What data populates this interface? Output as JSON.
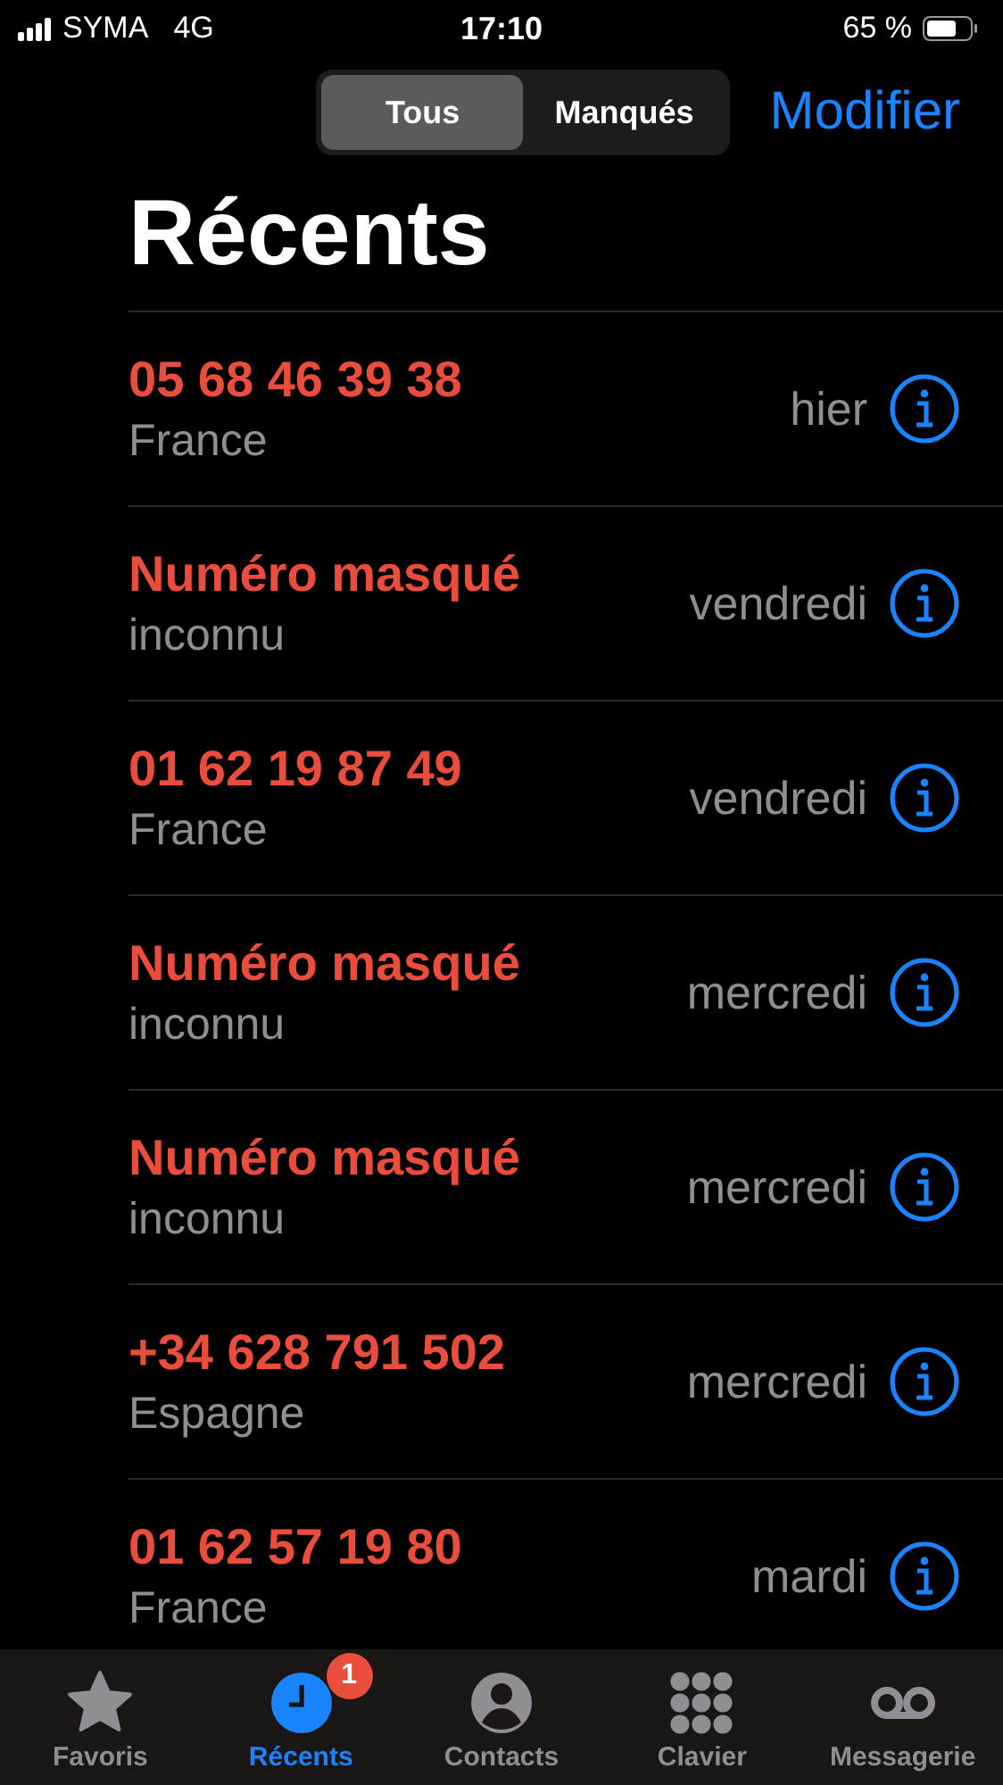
{
  "status_bar": {
    "carrier": "SYMA",
    "network": "4G",
    "time": "17:10",
    "battery": "65 %"
  },
  "segments": [
    {
      "label": "Tous",
      "selected": true
    },
    {
      "label": "Manqués",
      "selected": false
    }
  ],
  "edit_button": "Modifier",
  "title": "Récents",
  "calls": [
    {
      "caller": "05 68 46 39 38",
      "detail": "France",
      "date": "hier",
      "missed": true
    },
    {
      "caller": "Numéro masqué",
      "detail": "inconnu",
      "date": "vendredi",
      "missed": true
    },
    {
      "caller": "01 62 19 87 49",
      "detail": "France",
      "date": "vendredi",
      "missed": true
    },
    {
      "caller": "Numéro masqué",
      "detail": "inconnu",
      "date": "mercredi",
      "missed": true
    },
    {
      "caller": "Numéro masqué",
      "detail": "inconnu",
      "date": "mercredi",
      "missed": true
    },
    {
      "caller": "+34 628 791 502",
      "detail": "Espagne",
      "date": "mercredi",
      "missed": true
    },
    {
      "caller": "01 62 57 19 80",
      "detail": "France",
      "date": "mardi",
      "missed": true
    }
  ],
  "tabs": [
    {
      "kind": "star",
      "label": "Favoris",
      "selected": false
    },
    {
      "kind": "clock",
      "label": "Récents",
      "selected": true,
      "badge": "1"
    },
    {
      "kind": "person",
      "label": "Contacts",
      "selected": false
    },
    {
      "kind": "keypad",
      "label": "Clavier",
      "selected": false
    },
    {
      "kind": "voicemail",
      "label": "Messagerie",
      "selected": false
    }
  ]
}
